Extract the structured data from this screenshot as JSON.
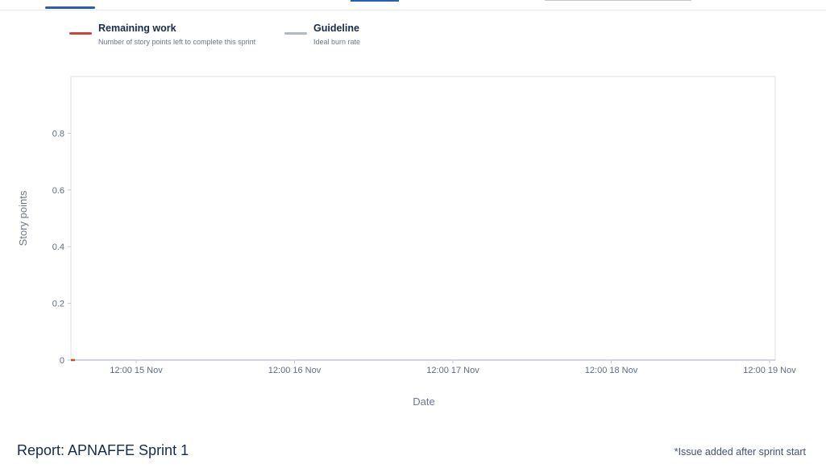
{
  "legend": [
    {
      "title": "Remaining work",
      "description": "Number of story points left to complete this sprint",
      "color": "#d04437"
    },
    {
      "title": "Guideline",
      "description": "Ideal burn rate",
      "color": "#b3b9c4"
    }
  ],
  "chart_data": {
    "type": "line",
    "xlabel": "Date",
    "ylabel": "Story points",
    "x_ticks": [
      "12:00 15 Nov",
      "12:00 16 Nov",
      "12:00 17 Nov",
      "12:00 18 Nov",
      "12:00 19 Nov"
    ],
    "y_ticks": [
      0,
      0.2,
      0.4,
      0.6,
      0.8
    ],
    "ylim": [
      0,
      1
    ],
    "series": [
      {
        "name": "Remaining work",
        "color": "#d04437",
        "points": [
          {
            "x": "15 Nov",
            "y": 0
          }
        ]
      },
      {
        "name": "Guideline",
        "color": "#b3b9c4",
        "points": []
      }
    ]
  },
  "report": {
    "title": "Report: APNAFFE Sprint 1",
    "footnote": "*Issue added after sprint start"
  }
}
